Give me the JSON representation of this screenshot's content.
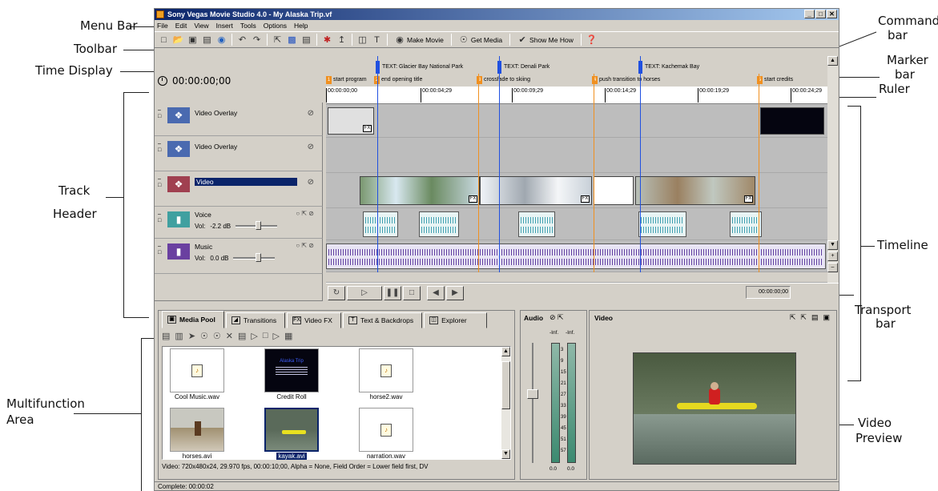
{
  "callouts": {
    "menu_bar": "Menu Bar",
    "toolbar": "Toolbar",
    "time_display": "Time Display",
    "track_header_1": "Track",
    "track_header_2": "Header",
    "multifunction_1": "Multifunction",
    "multifunction_2": "Area",
    "command_1": "Command",
    "command_2": "bar",
    "marker_1": "Marker",
    "marker_2": "bar",
    "ruler": "Ruler",
    "timeline": "Timeline",
    "transport_1": "Transport",
    "transport_2": "bar",
    "video_preview_1": "Video",
    "video_preview_2": "Preview"
  },
  "window": {
    "title": "Sony Vegas Movie Studio 4.0 - My Alaska Trip.vf",
    "min": "_",
    "max": "□",
    "close": "✕"
  },
  "menu": [
    "File",
    "Edit",
    "View",
    "Insert",
    "Tools",
    "Options",
    "Help"
  ],
  "toolbar": {
    "make_movie": "Make Movie",
    "get_media": "Get Media",
    "show_me_how": "Show Me How"
  },
  "time_display": "00:00:00;00",
  "markers": [
    {
      "label": "TEXT: Glacier Bay National Park"
    },
    {
      "label": "TEXT: Denali Park"
    },
    {
      "label": "TEXT: Kachemak Bay"
    }
  ],
  "regions": [
    {
      "num": "1",
      "label": "start program"
    },
    {
      "num": "2",
      "label": "end opening title"
    },
    {
      "num": "3",
      "label": "crossfade to skiing"
    },
    {
      "num": "4",
      "label": "push transition to horses"
    },
    {
      "num": "5",
      "label": "start credits"
    }
  ],
  "ruler": [
    "00:00:00;00",
    "00:00:04;29",
    "00:00:09;29",
    "00:00:14;29",
    "00:00:19;29",
    "00:00:24;29"
  ],
  "tracks": [
    {
      "name": "Video Overlay",
      "type": "video"
    },
    {
      "name": "Video Overlay",
      "type": "video"
    },
    {
      "name": "Video",
      "type": "video"
    },
    {
      "name": "Voice",
      "type": "audio",
      "vol_label": "Vol:",
      "vol_value": "-2.2 dB",
      "level": 0.55
    },
    {
      "name": "Music",
      "type": "audio",
      "vol_label": "Vol:",
      "vol_value": "0.0 dB",
      "level": 0.62
    }
  ],
  "fx_label": "FX",
  "transport": {
    "time": "00:00:00;00"
  },
  "tabs": [
    {
      "label": "Media Pool",
      "active": true
    },
    {
      "label": "Transitions"
    },
    {
      "label": "Video FX"
    },
    {
      "label": "Text & Backdrops"
    },
    {
      "label": "Explorer"
    }
  ],
  "media_items": [
    {
      "label": "Cool Music.wav",
      "kind": "audio"
    },
    {
      "label": "Credit Roll",
      "kind": "credits"
    },
    {
      "label": "horse2.wav",
      "kind": "audio"
    },
    {
      "label": "horses.avi",
      "kind": "video-horse"
    },
    {
      "label": "kayak.avi",
      "kind": "video-kayak",
      "selected": true
    },
    {
      "label": "narration.wav",
      "kind": "audio"
    }
  ],
  "credit_thumb_title": "Alaska Trip",
  "media_info": "Video: 720x480x24, 29.970 fps, 00:00:10;00, Alpha = None, Field Order = Lower field first, DV",
  "audio_panel": {
    "title": "Audio",
    "left_peak": "-Inf.",
    "right_peak": "-Inf.",
    "scale": [
      "3",
      "9",
      "15",
      "21",
      "27",
      "33",
      "39",
      "45",
      "51",
      "57"
    ],
    "left_value": "0.0",
    "right_value": "0.0"
  },
  "video_panel": {
    "title": "Video"
  },
  "status": "Complete: 00:00:02"
}
